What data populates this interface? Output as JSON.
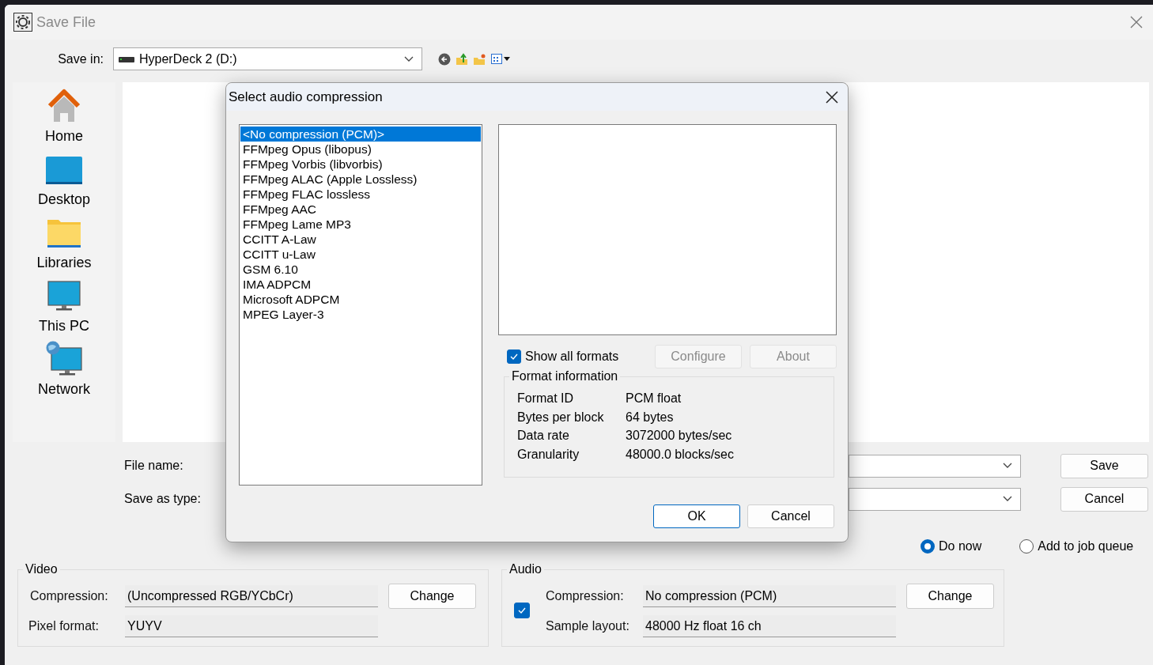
{
  "window": {
    "title": "Save File"
  },
  "save_in": {
    "label": "Save in:",
    "value": "HyperDeck 2 (D:)"
  },
  "places": [
    {
      "label": "Home",
      "kind": "home"
    },
    {
      "label": "Desktop",
      "kind": "desktop"
    },
    {
      "label": "Libraries",
      "kind": "libraries"
    },
    {
      "label": "This PC",
      "kind": "pc"
    },
    {
      "label": "Network",
      "kind": "network"
    }
  ],
  "file_name": {
    "label": "File name:"
  },
  "save_as_type": {
    "label": "Save as type:"
  },
  "save_button": "Save",
  "cancel_button": "Cancel",
  "timing": [
    {
      "label": "Do now",
      "selected": true
    },
    {
      "label": "Add to job queue",
      "selected": false
    }
  ],
  "video": {
    "title": "Video",
    "compression_label": "Compression:",
    "compression": "(Uncompressed RGB/YCbCr)",
    "change": "Change",
    "pixel_format_label": "Pixel format:",
    "pixel_format": "YUYV"
  },
  "audio": {
    "title": "Audio",
    "enabled": true,
    "compression_label": "Compression:",
    "compression": "No compression (PCM)",
    "change": "Change",
    "sample_layout_label": "Sample layout:",
    "sample_layout": "48000 Hz float 16 ch"
  },
  "dialog": {
    "title": "Select audio compression",
    "formats": [
      {
        "label": "<No compression (PCM)>",
        "selected": true
      },
      {
        "label": "FFMpeg Opus (libopus)",
        "selected": false
      },
      {
        "label": "FFMpeg Vorbis (libvorbis)",
        "selected": false
      },
      {
        "label": "FFMpeg ALAC (Apple Lossless)",
        "selected": false
      },
      {
        "label": "FFMpeg FLAC lossless",
        "selected": false
      },
      {
        "label": "FFMpeg AAC",
        "selected": false
      },
      {
        "label": "FFMpeg Lame MP3",
        "selected": false
      },
      {
        "label": "CCITT A-Law",
        "selected": false
      },
      {
        "label": "CCITT u-Law",
        "selected": false
      },
      {
        "label": "GSM 6.10",
        "selected": false
      },
      {
        "label": "IMA ADPCM",
        "selected": false
      },
      {
        "label": "Microsoft ADPCM",
        "selected": false
      },
      {
        "label": "MPEG Layer-3",
        "selected": false
      }
    ],
    "show_all_formats": {
      "label": "Show all formats",
      "checked": true
    },
    "configure": {
      "label": "Configure",
      "disabled": true
    },
    "about": {
      "label": "About",
      "disabled": true
    },
    "format_info": {
      "title": "Format information",
      "rows": [
        {
          "name": "Format ID",
          "value": "PCM float"
        },
        {
          "name": "Bytes per block",
          "value": "64 bytes"
        },
        {
          "name": "Data rate",
          "value": "3072000 bytes/sec"
        },
        {
          "name": "Granularity",
          "value": "48000.0 blocks/sec"
        }
      ]
    },
    "ok": "OK",
    "cancel": "Cancel"
  }
}
